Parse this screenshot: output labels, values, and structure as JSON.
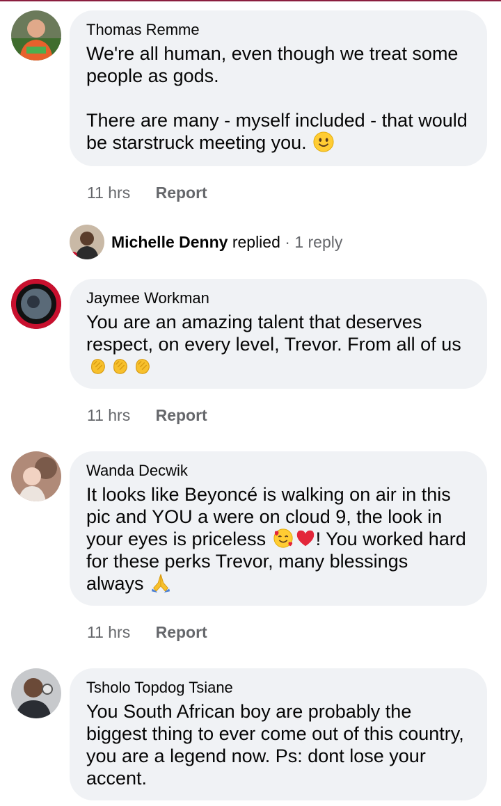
{
  "comments": [
    {
      "author": "Thomas Remme",
      "paragraph1": "We're all human, even though we treat some people as gods.",
      "paragraph2": "There are many - myself included - that would be starstruck meeting you.",
      "time": "11 hrs",
      "report_label": "Report"
    },
    {
      "author": "Jaymee Workman",
      "text": "You are an amazing talent that deserves respect, on every level, Trevor. From all of us",
      "time": "11 hrs",
      "report_label": "Report"
    },
    {
      "author": "Wanda Decwik",
      "text_part1": "It looks like Beyoncé is walking on air in this pic and YOU a were on cloud 9, the look in your eyes is priceless",
      "text_part2": "! You worked hard for these perks Trevor, many blessings always",
      "time": "11 hrs",
      "report_label": "Report"
    },
    {
      "author": "Tsholo Topdog Tsiane",
      "text": "You South African boy are probably the biggest thing to ever come out of this country, you are a legend now. Ps: dont lose your accent."
    }
  ],
  "reply_summary": {
    "name": "Michelle Denny",
    "action": "replied",
    "separator": "·",
    "count": "1 reply"
  },
  "icons": [
    "smiley-emoji-icon",
    "clapping-hands-emoji-icon",
    "smiling-face-with-hearts-emoji-icon",
    "red-heart-emoji-icon",
    "praying-hands-emoji-icon"
  ],
  "colors": {
    "bubble": "#f0f2f5",
    "meta_text": "#65676b",
    "primary_text": "#050505"
  }
}
